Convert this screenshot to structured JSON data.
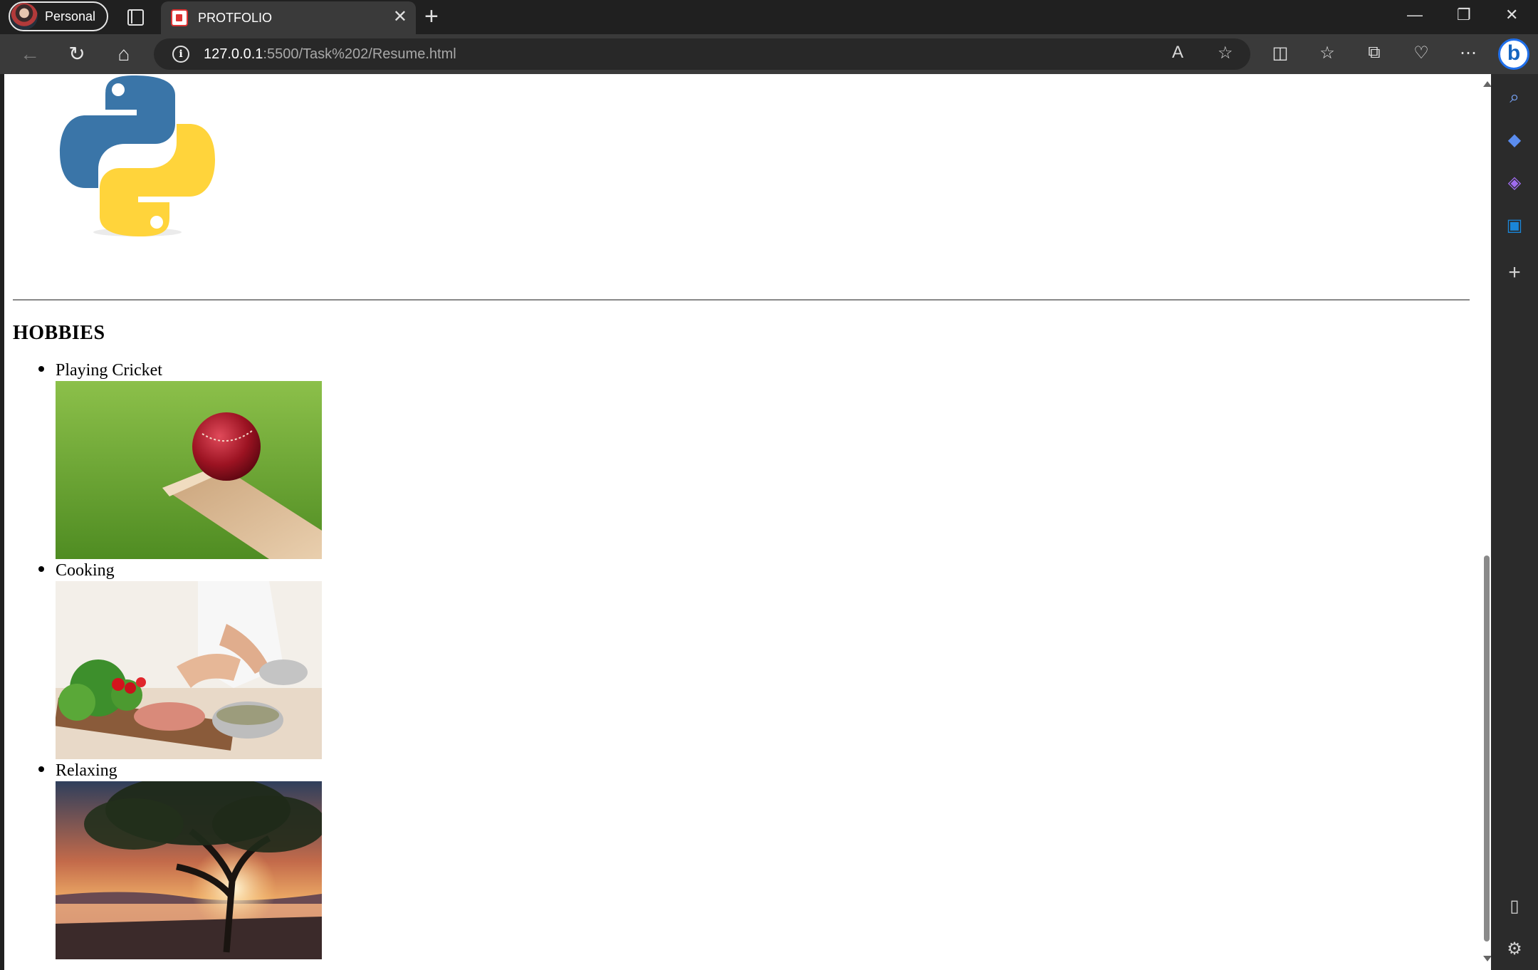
{
  "browser": {
    "profile_label": "Personal",
    "tab_title": "PROTFOLIO",
    "tab_close": "✕",
    "new_tab": "+",
    "address_host": "127.0.0.1",
    "address_path": ":5500/Task%202/Resume.html",
    "window_controls": {
      "minimize": "—",
      "restore": "❐",
      "close": "✕"
    }
  },
  "toolbar_icons": [
    "back-icon",
    "refresh-icon",
    "home-icon",
    "read-aloud-icon",
    "favorite-star-icon",
    "split-screen-icon",
    "favorites-icon",
    "collections-icon",
    "performance-icon",
    "more-icon",
    "bing-copilot-icon"
  ],
  "sidebar_icons": [
    "search-icon",
    "shopping-icon",
    "copilot-icon",
    "outlook-icon",
    "add-icon",
    "sidebar-toggle-icon",
    "settings-icon"
  ],
  "page": {
    "section_title": "HOBBIES",
    "hobbies": [
      {
        "label": "Playing Cricket",
        "image": "cricket ball on bat on grass"
      },
      {
        "label": "Cooking",
        "image": "hands chopping vegetables in kitchen"
      },
      {
        "label": "Relaxing",
        "image": "tree silhouette at sunset by lake"
      }
    ]
  },
  "colors": {
    "browser_dark": "#202020",
    "toolbar": "#3a3a3a",
    "python_blue": "#3a75a8",
    "python_yellow": "#ffd43b"
  }
}
